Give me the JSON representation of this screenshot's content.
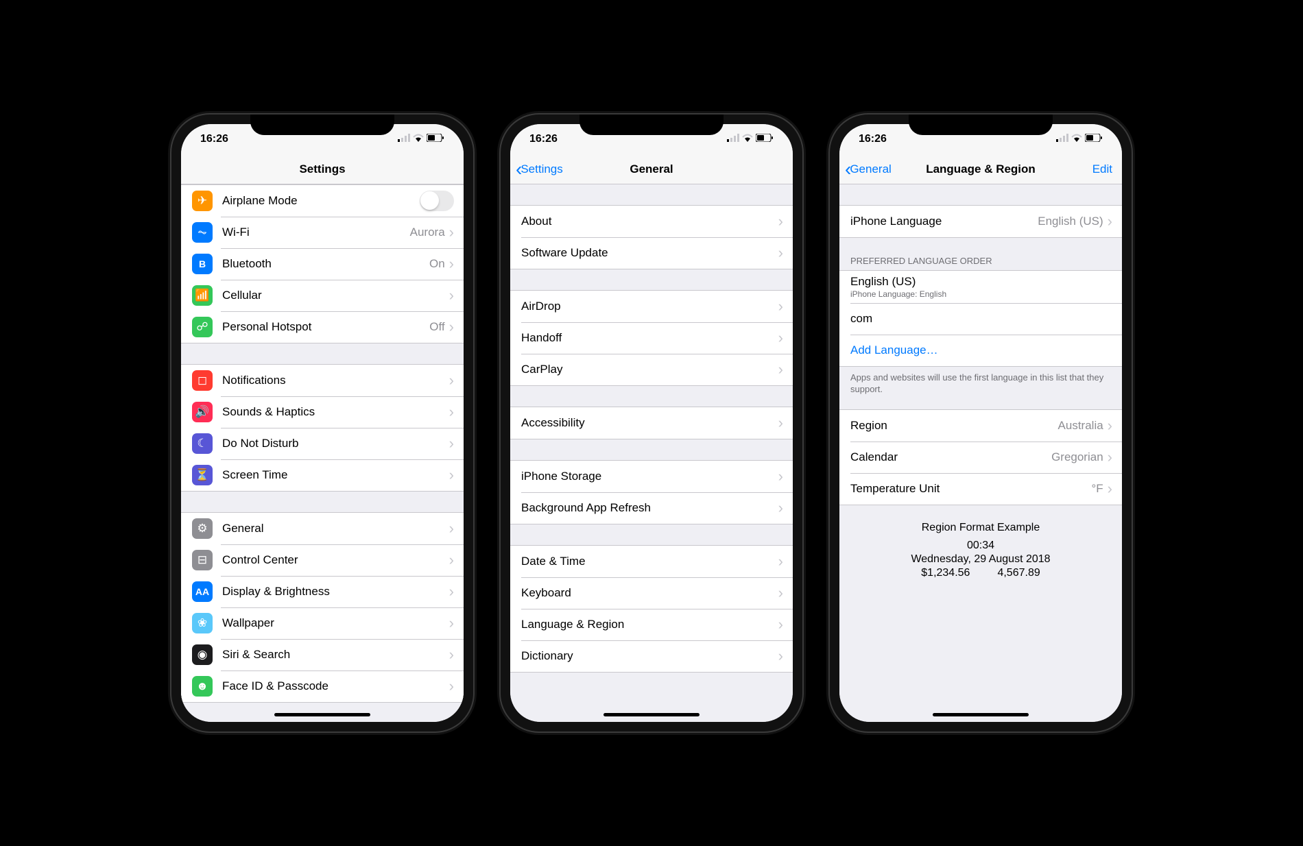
{
  "statusbar": {
    "time": "16:26"
  },
  "phone1": {
    "title": "Settings",
    "rows_g1": [
      {
        "label": "Airplane Mode",
        "type": "toggle",
        "on": false,
        "icon": "airplane-icon",
        "bg": "bg-orange",
        "glyph": "✈"
      },
      {
        "label": "Wi-Fi",
        "value": "Aurora",
        "icon": "wifi-icon",
        "bg": "bg-blue",
        "glyph": "⏦"
      },
      {
        "label": "Bluetooth",
        "value": "On",
        "icon": "bluetooth-icon",
        "bg": "bg-blue",
        "glyph": "B"
      },
      {
        "label": "Cellular",
        "value": "",
        "icon": "cellular-icon",
        "bg": "bg-green",
        "glyph": "📶"
      },
      {
        "label": "Personal Hotspot",
        "value": "Off",
        "icon": "hotspot-icon",
        "bg": "bg-green",
        "glyph": "☍"
      }
    ],
    "rows_g2": [
      {
        "label": "Notifications",
        "icon": "notifications-icon",
        "bg": "bg-red",
        "glyph": "◻"
      },
      {
        "label": "Sounds & Haptics",
        "icon": "sounds-icon",
        "bg": "bg-pink",
        "glyph": "🔊"
      },
      {
        "label": "Do Not Disturb",
        "icon": "dnd-icon",
        "bg": "bg-purple",
        "glyph": "☾"
      },
      {
        "label": "Screen Time",
        "icon": "screentime-icon",
        "bg": "bg-purple",
        "glyph": "⏳"
      }
    ],
    "rows_g3": [
      {
        "label": "General",
        "icon": "general-icon",
        "bg": "bg-grey",
        "glyph": "⚙"
      },
      {
        "label": "Control Center",
        "icon": "controlcenter-icon",
        "bg": "bg-grey",
        "glyph": "⊟"
      },
      {
        "label": "Display & Brightness",
        "icon": "display-icon",
        "bg": "bg-blue",
        "glyph": "AA"
      },
      {
        "label": "Wallpaper",
        "icon": "wallpaper-icon",
        "bg": "bg-lightblue",
        "glyph": "❀"
      },
      {
        "label": "Siri & Search",
        "icon": "siri-icon",
        "bg": "bg-dark",
        "glyph": "◉"
      },
      {
        "label": "Face ID & Passcode",
        "icon": "faceid-icon",
        "bg": "bg-green",
        "glyph": "☻"
      }
    ]
  },
  "phone2": {
    "back": "Settings",
    "title": "General",
    "g1": [
      {
        "label": "About"
      },
      {
        "label": "Software Update"
      }
    ],
    "g2": [
      {
        "label": "AirDrop"
      },
      {
        "label": "Handoff"
      },
      {
        "label": "CarPlay"
      }
    ],
    "g3": [
      {
        "label": "Accessibility"
      }
    ],
    "g4": [
      {
        "label": "iPhone Storage"
      },
      {
        "label": "Background App Refresh"
      }
    ],
    "g5": [
      {
        "label": "Date & Time"
      },
      {
        "label": "Keyboard"
      },
      {
        "label": "Language & Region"
      },
      {
        "label": "Dictionary"
      }
    ]
  },
  "phone3": {
    "back": "General",
    "title": "Language & Region",
    "edit": "Edit",
    "iphone_lang_label": "iPhone Language",
    "iphone_lang_value": "English (US)",
    "pref_header": "PREFERRED LANGUAGE ORDER",
    "lang1": "English (US)",
    "lang1_sub": "iPhone Language: English",
    "lang2": "com",
    "add_lang": "Add Language…",
    "footer": "Apps and websites will use the first language in this list that they support.",
    "region_label": "Region",
    "region_value": "Australia",
    "calendar_label": "Calendar",
    "calendar_value": "Gregorian",
    "temp_label": "Temperature Unit",
    "temp_value": "°F",
    "example_title": "Region Format Example",
    "example_time": "00:34",
    "example_date": "Wednesday, 29 August 2018",
    "example_num1": "$1,234.56",
    "example_num2": "4,567.89"
  }
}
